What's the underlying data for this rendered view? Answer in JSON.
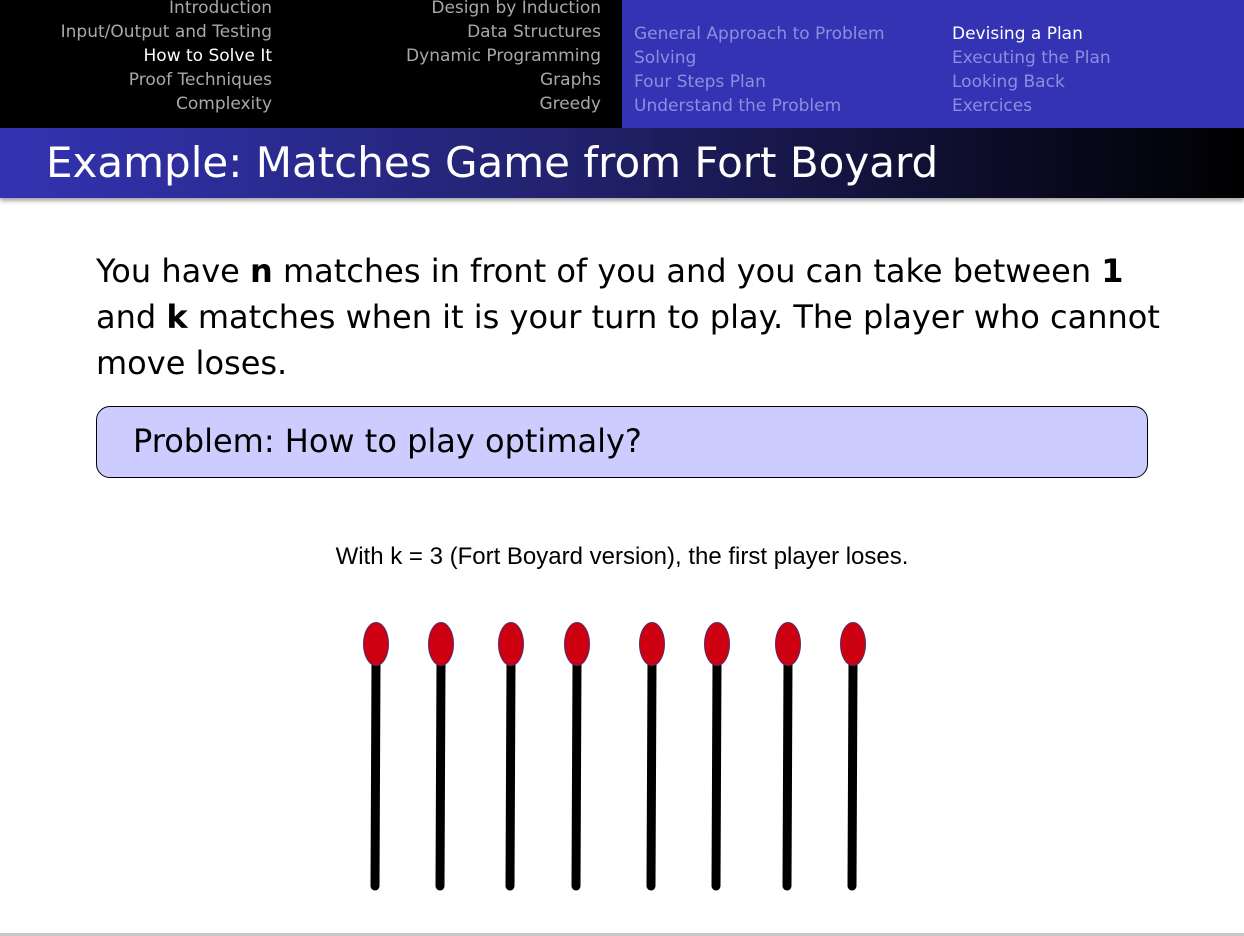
{
  "nav": {
    "sections_col1": [
      {
        "label": "Introduction",
        "active": false
      },
      {
        "label": "Input/Output and Testing",
        "active": false
      },
      {
        "label": "How to Solve It",
        "active": true
      },
      {
        "label": "Proof Techniques",
        "active": false
      },
      {
        "label": "Complexity",
        "active": false
      }
    ],
    "sections_col2": [
      {
        "label": "Design by Induction",
        "active": false
      },
      {
        "label": "Data Structures",
        "active": false
      },
      {
        "label": "Dynamic Programming",
        "active": false
      },
      {
        "label": "Graphs",
        "active": false
      },
      {
        "label": "Greedy",
        "active": false
      }
    ],
    "subsections_col1": [
      {
        "label": "General Approach to Problem Solving",
        "active": false
      },
      {
        "label": "Four Steps Plan",
        "active": false
      },
      {
        "label": "Understand the Problem",
        "active": false
      }
    ],
    "subsections_col2": [
      {
        "label": "Devising a Plan",
        "active": true
      },
      {
        "label": "Executing the Plan",
        "active": false
      },
      {
        "label": "Looking Back",
        "active": false
      },
      {
        "label": "Exercices",
        "active": false
      }
    ]
  },
  "frame": {
    "title": "Example: Matches Game from Fort Boyard"
  },
  "body": {
    "part1": "You have ",
    "n": "n",
    "part2": " matches in front of you and you can take between ",
    "one": "1",
    "part3": " and ",
    "k": "k",
    "part4": " matches when it is your turn to play.  The player who cannot move loses."
  },
  "problem": {
    "text": "Problem: How to play optimaly?"
  },
  "caption": "With k = 3 (Fort Boyard version), the first player loses.",
  "matches": {
    "count": 8,
    "head_color": "#cc0011",
    "stick_color": "#000000"
  }
}
